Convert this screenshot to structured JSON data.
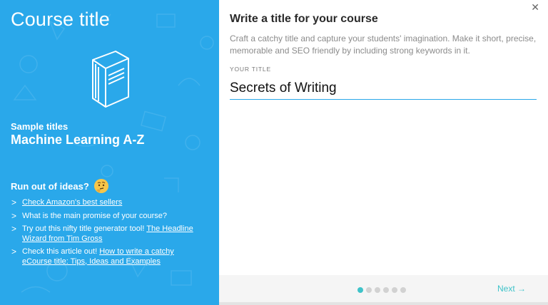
{
  "sidebar": {
    "title": "Course title",
    "sample_label": "Sample titles",
    "sample_value": "Machine Learning A-Z",
    "ideas_heading": "Run out of ideas?",
    "thinking_icon": "thinking-face-emoji",
    "tips": [
      {
        "prefix": "",
        "link": "Check Amazon's best sellers",
        "link2": ""
      },
      {
        "prefix": "What is the main promise of your course?",
        "link": "",
        "link2": ""
      },
      {
        "prefix": "Try out this nifty title generator tool! ",
        "link": "The Headline",
        "link2": "Wizard from Tim Gross"
      },
      {
        "prefix": "Check this article out! ",
        "link": "How to write a catchy",
        "link2": "eCourse title: Tips, Ideas and Examples"
      }
    ],
    "bg_color": "#2aa8ea"
  },
  "main": {
    "close_label": "✕",
    "heading": "Write a title for your course",
    "description": "Craft a catchy title and capture your students' imagination. Make it short, precise, memorable and SEO friendly by including strong keywords in it.",
    "field_label": "YOUR TITLE",
    "title_value": "Secrets of Writing",
    "accent_color": "#3fc3c9"
  },
  "footer": {
    "steps_total": 6,
    "steps_current": 1,
    "next_label": "Next →"
  }
}
